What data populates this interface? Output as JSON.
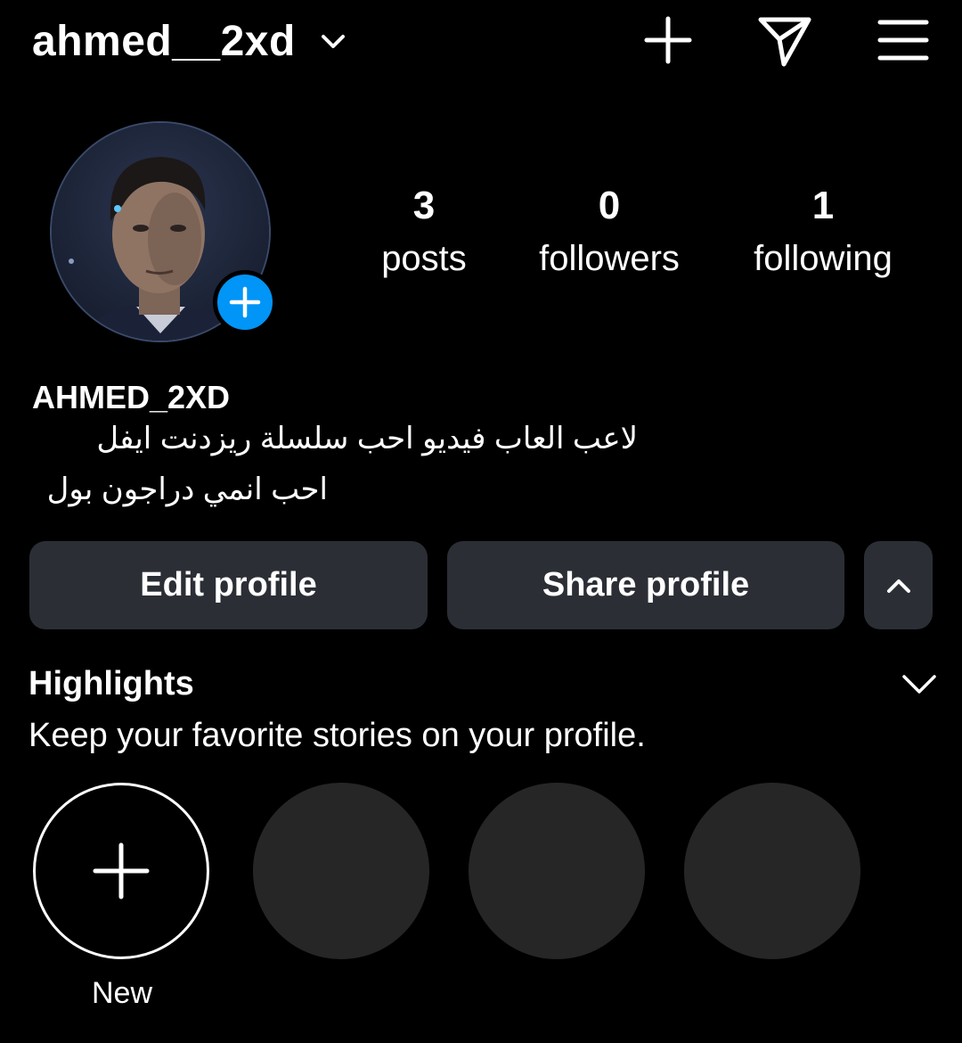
{
  "header": {
    "username": "ahmed__2xd",
    "icons": [
      "chevron-down-icon",
      "plus-icon",
      "direct-message-icon",
      "menu-icon"
    ]
  },
  "profile": {
    "avatar": "profile-photo",
    "stats": [
      {
        "value": "3",
        "label": "posts"
      },
      {
        "value": "0",
        "label": "followers"
      },
      {
        "value": "1",
        "label": "following"
      }
    ],
    "full_name": "AHMED_2XD",
    "bio_lines": [
      "لاعب العاب فيديو احب سلسلة ريزدنت ايفل",
      "احب انمي دراجون بول"
    ]
  },
  "actions": {
    "edit_label": "Edit profile",
    "share_label": "Share profile"
  },
  "highlights": {
    "title": "Highlights",
    "subtitle": "Keep your favorite stories on your profile.",
    "new_label": "New"
  },
  "colors": {
    "background": "#000000",
    "button": "#2b2f35",
    "accent": "#0095f6",
    "placeholder": "#262626"
  }
}
